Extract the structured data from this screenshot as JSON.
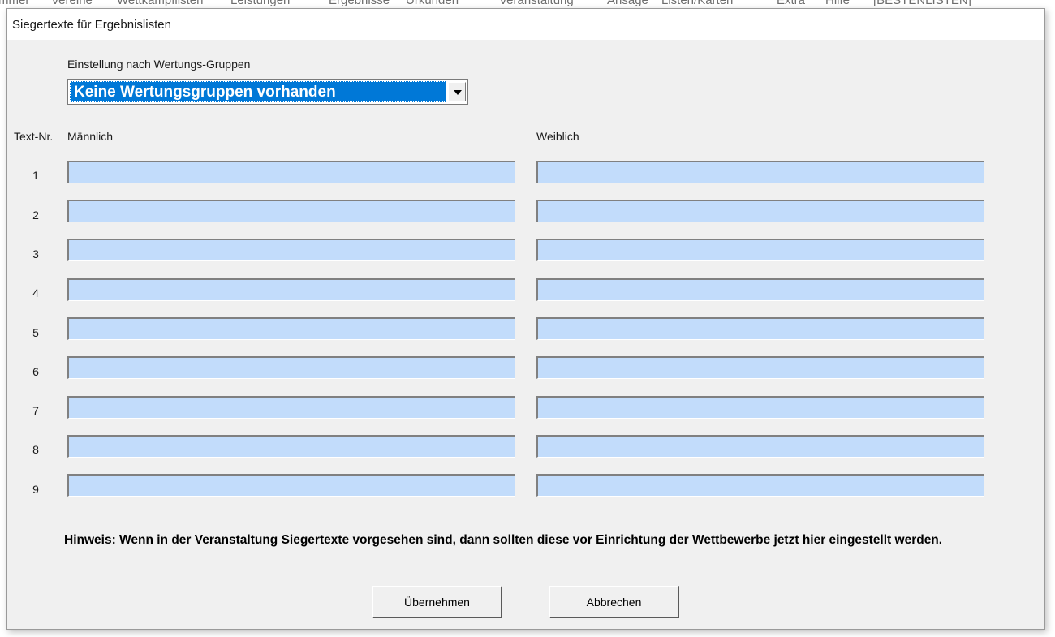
{
  "menubar": {
    "items": [
      "mmer",
      "Vereine",
      "Wettkampflisten",
      "Leistungen",
      "Ergebnisse",
      "Urkunden",
      "Veranstaltung",
      "Ansage",
      "Listen/Karten",
      "Extra",
      "Hilfe",
      "[BESTENLISTEN]"
    ]
  },
  "dialog": {
    "title": "Siegertexte für Ergebnislisten"
  },
  "group": {
    "label": "Einstellung nach Wertungs-Gruppen",
    "selected": "Keine Wertungsgruppen vorhanden"
  },
  "columns": {
    "number": "Text-Nr.",
    "male": "Männlich",
    "female": "Weiblich"
  },
  "rows": [
    {
      "num": "1",
      "male": "",
      "female": ""
    },
    {
      "num": "2",
      "male": "",
      "female": ""
    },
    {
      "num": "3",
      "male": "",
      "female": ""
    },
    {
      "num": "4",
      "male": "",
      "female": ""
    },
    {
      "num": "5",
      "male": "",
      "female": ""
    },
    {
      "num": "6",
      "male": "",
      "female": ""
    },
    {
      "num": "7",
      "male": "",
      "female": ""
    },
    {
      "num": "8",
      "male": "",
      "female": ""
    },
    {
      "num": "9",
      "male": "",
      "female": ""
    }
  ],
  "hint": "Hinweis: Wenn in der Veranstaltung Siegertexte vorgesehen sind, dann sollten diese vor Einrichtung der Wettbewerbe jetzt hier eingestellt werden.",
  "buttons": {
    "apply": "Übernehmen",
    "cancel": "Abbrechen"
  },
  "colors": {
    "field_bg": "#c2dcfb",
    "selection": "#0078d7",
    "dialog_bg": "#f0f0f0"
  }
}
